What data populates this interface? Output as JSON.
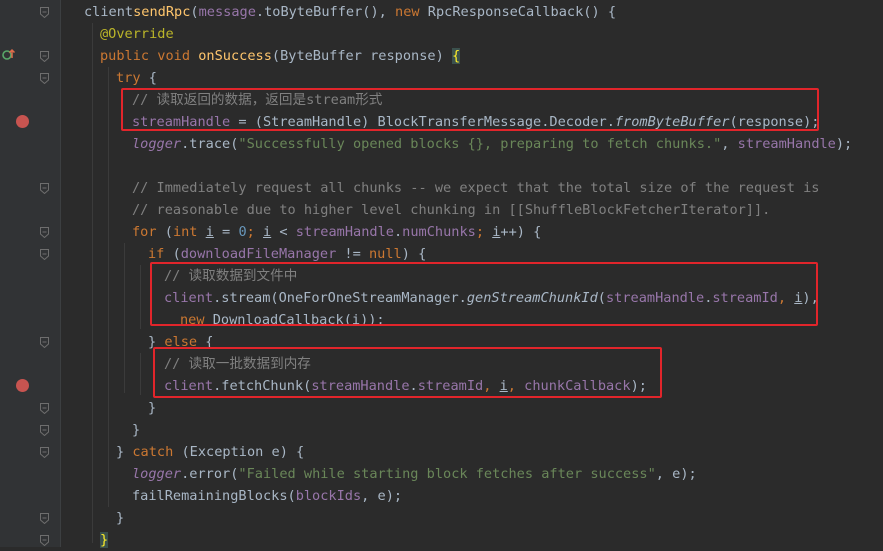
{
  "editor": {
    "language": "java",
    "lines": [
      {
        "parts": [
          [
            "",
            "client"
          ],
          [
            ".",
            ""
          ],
          [
            "fn",
            "sendRpc"
          ],
          [
            "",
            "("
          ],
          [
            "fld",
            "message"
          ],
          [
            "",
            ".toByteBuffer(), "
          ],
          [
            "kw",
            "new "
          ],
          [
            "",
            "RpcResponseCallback() {"
          ]
        ]
      },
      {
        "parts": [
          [
            "ann",
            "@Override"
          ]
        ]
      },
      {
        "parts": [
          [
            "kw",
            "public void "
          ],
          [
            "fn",
            "onSuccess"
          ],
          [
            "",
            "(ByteBuffer response) "
          ],
          [
            "bh",
            "{"
          ]
        ]
      },
      {
        "parts": [
          [
            "kw",
            "try "
          ],
          [
            "",
            "{"
          ]
        ]
      },
      {
        "parts": [
          [
            "cm",
            "// 读取返回的数据，返回是stream形式"
          ]
        ]
      },
      {
        "parts": [
          [
            "fld",
            "streamHandle"
          ],
          [
            "",
            " = (StreamHandle) BlockTransferMessage.Decoder."
          ],
          [
            "it",
            "fromByteBuffer"
          ],
          [
            "",
            "(response);"
          ]
        ]
      },
      {
        "parts": [
          [
            "fldit",
            "logger"
          ],
          [
            "",
            ".trace("
          ],
          [
            "str",
            "\"Successfully opened blocks {}, preparing to fetch chunks.\""
          ],
          [
            "",
            ", "
          ],
          [
            "fld",
            "streamHandle"
          ],
          [
            "",
            ");"
          ]
        ]
      },
      {
        "parts": []
      },
      {
        "parts": [
          [
            "cm",
            "// Immediately request all chunks -- we expect that the total size of the request is"
          ]
        ]
      },
      {
        "parts": [
          [
            "cm",
            "// reasonable due to higher level chunking in [[ShuffleBlockFetcherIterator]]."
          ]
        ]
      },
      {
        "parts": [
          [
            "kw",
            "for "
          ],
          [
            "",
            "("
          ],
          [
            "kw",
            "int "
          ],
          [
            "und",
            "i"
          ],
          [
            "",
            " = "
          ],
          [
            "num",
            "0"
          ],
          [
            "kw",
            ";"
          ],
          [
            "",
            " "
          ],
          [
            "und",
            "i"
          ],
          [
            "",
            " < "
          ],
          [
            "fld",
            "streamHandle"
          ],
          [
            "",
            "."
          ],
          [
            "fld",
            "numChunks"
          ],
          [
            "kw",
            "; "
          ],
          [
            "und",
            "i"
          ],
          [
            "",
            "++) {"
          ]
        ]
      },
      {
        "parts": [
          [
            "kw",
            "if "
          ],
          [
            "",
            "("
          ],
          [
            "fld",
            "downloadFileManager"
          ],
          [
            "",
            " != "
          ],
          [
            "kw",
            "null"
          ],
          [
            "",
            ") {"
          ]
        ]
      },
      {
        "parts": [
          [
            "cm",
            "// 读取数据到文件中"
          ]
        ]
      },
      {
        "parts": [
          [
            "fld",
            "client"
          ],
          [
            "",
            ".stream(OneForOneStreamManager."
          ],
          [
            "it",
            "genStreamChunkId"
          ],
          [
            "",
            "("
          ],
          [
            "fld",
            "streamHandle"
          ],
          [
            "",
            "."
          ],
          [
            "fld",
            "streamId"
          ],
          [
            "kw",
            ", "
          ],
          [
            "und",
            "i"
          ],
          [
            "",
            "),"
          ]
        ]
      },
      {
        "parts": [
          [
            "kw",
            "new "
          ],
          [
            "",
            "DownloadCallback(i));"
          ]
        ]
      },
      {
        "parts": [
          [
            "",
            "} "
          ],
          [
            "kw",
            "else "
          ],
          [
            "",
            "{"
          ]
        ]
      },
      {
        "parts": [
          [
            "cm",
            "// 读取一批数据到内存"
          ]
        ]
      },
      {
        "parts": [
          [
            "fld",
            "client"
          ],
          [
            "",
            ".fetchChunk("
          ],
          [
            "fld",
            "streamHandle"
          ],
          [
            "",
            "."
          ],
          [
            "fld",
            "streamId"
          ],
          [
            "kw",
            ", "
          ],
          [
            "und",
            "i"
          ],
          [
            "kw",
            ", "
          ],
          [
            "fld",
            "chunkCallback"
          ],
          [
            "",
            ");"
          ]
        ]
      },
      {
        "parts": [
          [
            "",
            "}"
          ]
        ]
      },
      {
        "parts": [
          [
            "",
            "}"
          ]
        ]
      },
      {
        "parts": [
          [
            "",
            "} "
          ],
          [
            "kw",
            "catch "
          ],
          [
            "",
            "(Exception e) {"
          ]
        ]
      },
      {
        "parts": [
          [
            "fldit",
            "logger"
          ],
          [
            "",
            ".error("
          ],
          [
            "str",
            "\"Failed while starting block fetches after success\""
          ],
          [
            "",
            ", e);"
          ]
        ]
      },
      {
        "parts": [
          [
            "",
            "failRemainingBlocks("
          ],
          [
            "fld",
            "blockIds"
          ],
          [
            "",
            ", e);"
          ]
        ]
      },
      {
        "parts": [
          [
            "",
            "}"
          ]
        ]
      },
      {
        "parts": [
          [
            "bh",
            "}"
          ]
        ]
      }
    ]
  },
  "colors": {
    "background": "#2b2b2b",
    "keyword": "#cc7832",
    "method": "#ffc66d",
    "field": "#9876aa",
    "comment": "#808080",
    "string": "#6a8759",
    "number": "#6897bb",
    "annotation": "#bbb529",
    "breakpoint": "#c75450",
    "highlight_box": "#e1252b"
  },
  "icons": {
    "breakpoint": "breakpoint-icon",
    "fold": "fold-marker-icon",
    "implements": "override-marker-icon"
  }
}
